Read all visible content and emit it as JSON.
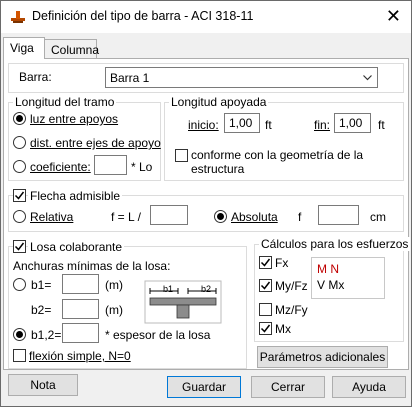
{
  "window": {
    "title": "Definición del tipo de barra - ACI 318-11"
  },
  "tabs": [
    {
      "label": "Viga"
    },
    {
      "label": "Columna"
    }
  ],
  "barra": {
    "label": "Barra:",
    "value": "Barra 1"
  },
  "longitud_tramo": {
    "title": "Longitud del tramo",
    "opt_luz": "luz entre apoyos",
    "opt_dist": "dist. entre ejes de apoyo",
    "opt_coef": "coeficiente:",
    "coef_value": "",
    "coef_suffix": "* Lo"
  },
  "longitud_apoyada": {
    "title": "Longitud apoyada",
    "inicio_label": "inicio:",
    "inicio_value": "1,00",
    "inicio_unit": "ft",
    "fin_label": "fin:",
    "fin_value": "1,00",
    "fin_unit": "ft",
    "conforme_line1": "conforme con la geometría de la",
    "conforme_line2": "estructura"
  },
  "flecha": {
    "label": "Flecha admisible",
    "relativa": "Relativa",
    "formula": "f = L /",
    "relativa_value": "",
    "absoluta": "Absoluta",
    "f_label": "f",
    "absoluta_value": "",
    "unit": "cm"
  },
  "losa": {
    "label": "Losa colaborante",
    "anchuras": "Anchuras mínimas de la losa:",
    "b1_label": "b1=",
    "b1_value": "",
    "b1_unit": "(m)",
    "b2_label": "b2=",
    "b2_value": "",
    "b2_unit": "(m)",
    "b12_label": "b1,2=",
    "b12_value": "",
    "b12_suffix": "* espesor de la losa",
    "fig_b1": "b1",
    "fig_b2": "b2",
    "flexion": "flexión simple, N=0"
  },
  "calculos": {
    "title": "Cálculos para los esfuerzos",
    "fx": "Fx",
    "myfz": "My/Fz",
    "mzfy": "Mz/Fy",
    "mx": "Mx",
    "legend_mn": "M N",
    "legend_vmx": "V Mx",
    "parametros": "Parámetros adicionales"
  },
  "buttons": {
    "nota": "Nota",
    "guardar": "Guardar",
    "cerrar": "Cerrar",
    "ayuda": "Ayuda"
  },
  "colors": {
    "accent": "#0078d7",
    "legend_red": "#c00000"
  }
}
